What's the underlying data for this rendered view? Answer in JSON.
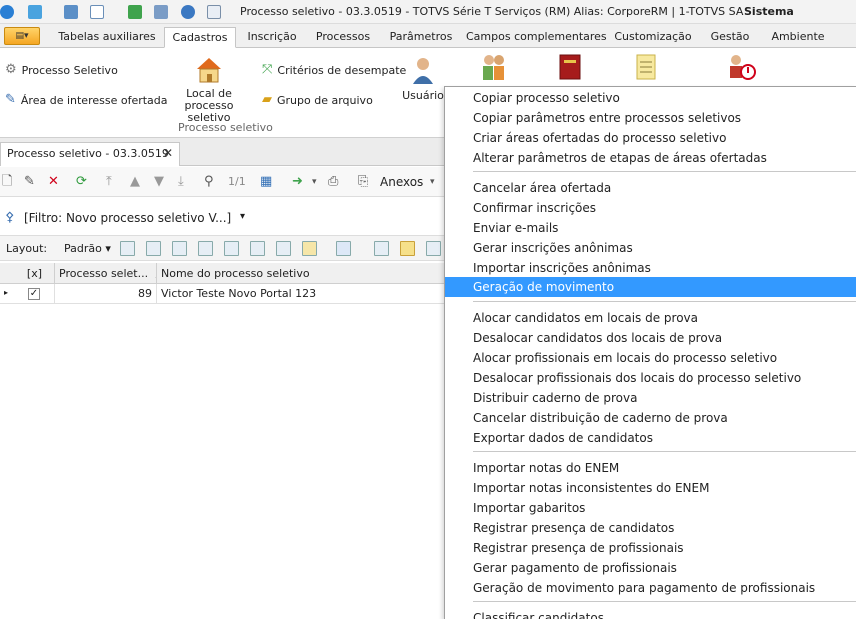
{
  "window": {
    "title": "Processo seletivo - 03.3.0519 - TOTVS Série T Serviços (RM) Alias: CorporeRM | 1-TOTVS SA",
    "right_label": "Sistema"
  },
  "ribbon_tabs": [
    "Tabelas auxiliares",
    "Cadastros",
    "Inscrição",
    "Processos",
    "Parâmetros",
    "Campos complementares",
    "Customização",
    "Gestão",
    "Ambiente"
  ],
  "active_tab": "Cadastros",
  "ribbon": {
    "processo_seletivo": "Processo Seletivo",
    "area_interesse": "Área de interesse ofertada",
    "local_processo": "Local de processo seletivo",
    "criterios": "Critérios de desempate",
    "grupo_arquivo": "Grupo de arquivo",
    "usuario": "Usuário",
    "group_label": "Processo seletivo"
  },
  "document_tab": {
    "label": "Processo seletivo - 03.3.0519",
    "close": "✕"
  },
  "toolbar": {
    "page": "1/1",
    "anexos": "Anexos"
  },
  "filter": {
    "label": "[Filtro: Novo processo seletivo V...]"
  },
  "layout": {
    "label": "Layout:",
    "value": "Padrão"
  },
  "grid": {
    "columns": [
      "[x]",
      "Processo selet...",
      "Nome do processo seletivo"
    ],
    "rows": [
      {
        "checked": "✓",
        "id": "89",
        "name": "Victor Teste Novo Portal 123"
      }
    ]
  },
  "context_menu": {
    "items": [
      "Copiar processo seletivo",
      "Copiar parâmetros entre processos seletivos",
      "Criar áreas ofertadas do processo seletivo",
      "Alterar parâmetros de etapas de áreas ofertadas",
      "Cancelar área ofertada",
      "Confirmar inscrições",
      "Enviar e-mails",
      "Gerar inscrições anônimas",
      "Importar inscrições anônimas",
      "Geração de movimento",
      "Alocar candidatos em locais de prova",
      "Desalocar candidatos dos locais de prova",
      "Alocar profissionais em locais do processo seletivo",
      "Desalocar profissionais dos locais do processo seletivo",
      "Distribuir caderno de prova",
      "Cancelar distribuição de caderno de prova",
      "Exportar dados de candidatos",
      "Importar notas do ENEM",
      "Importar notas inconsistentes do ENEM",
      "Importar gabaritos",
      "Registrar presença de candidatos",
      "Registrar presença de profissionais",
      "Gerar pagamento de profissionais",
      "Geração de movimento para pagamento de profissionais",
      "Classificar candidatos"
    ],
    "highlighted": "Geração de movimento"
  },
  "colors": {
    "highlight": "#3399ff",
    "app_button": "#f5a623"
  }
}
